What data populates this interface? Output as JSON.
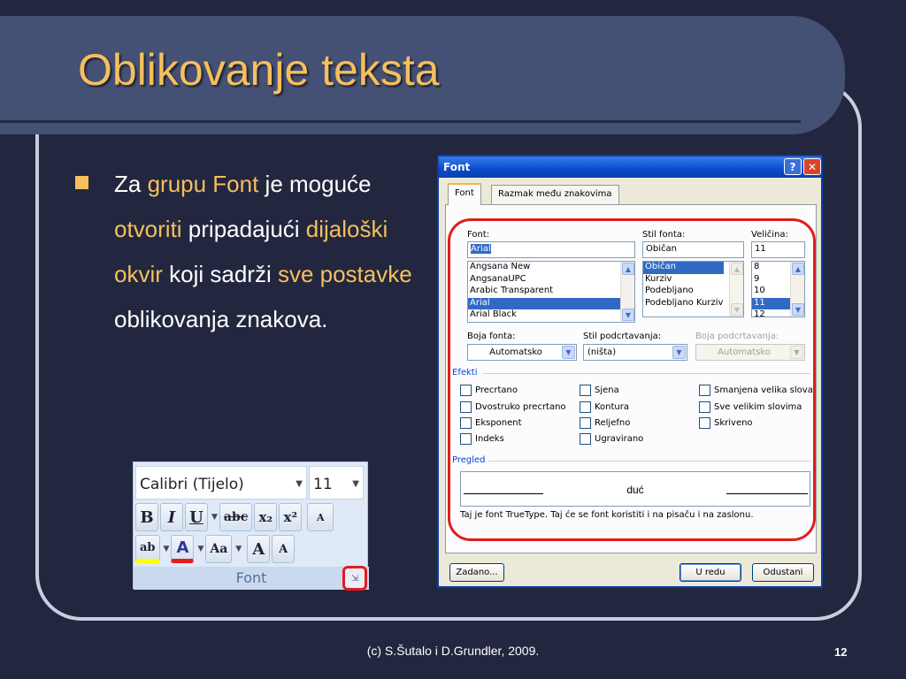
{
  "slide": {
    "title": "Oblikovanje teksta",
    "footer": "(c) S.Šutalo i D.Grundler, 2009.",
    "page_number": "12",
    "bullet": {
      "t1": "Za ",
      "t2": "grupu Font",
      "t3": " je moguće ",
      "t4": "otvoriti",
      "t5": " pripadajući ",
      "t6": "dijaloški okvir",
      "t7": " koji sadrži ",
      "t8": "sve postavke",
      "t9": " oblikovanja znakova."
    }
  },
  "ribbon": {
    "font_name": "Calibri (Tijelo)",
    "font_size": "11",
    "group_label": "Font",
    "buttons": {
      "bold": "B",
      "italic": "I",
      "underline": "U",
      "strikethrough": "abc",
      "subscript": "x₂",
      "superscript": "x²",
      "clear": "A",
      "highlight": "ab",
      "font_color": "A",
      "change_case": "Aa",
      "grow": "A",
      "shrink": "A"
    }
  },
  "dialog": {
    "title": "Font",
    "help": "?",
    "close": "✕",
    "tabs": [
      "Font",
      "Razmak među znakovima"
    ],
    "font_label": "Font:",
    "font_value": "Arial",
    "font_list": [
      "Angsana New",
      "AngsanaUPC",
      "Arabic Transparent",
      "Arial",
      "Arial Black"
    ],
    "font_selected": "Arial",
    "style_label": "Stil fonta:",
    "style_value": "Običan",
    "style_list": [
      "Običan",
      "Kurziv",
      "Podebljano",
      "Podebljano Kurziv"
    ],
    "size_label": "Veličina:",
    "size_value": "11",
    "size_list": [
      "8",
      "9",
      "10",
      "11",
      "12"
    ],
    "color_label": "Boja fonta:",
    "color_value": "Automatsko",
    "underline_label": "Stil podcrtavanja:",
    "underline_value": "(ništa)",
    "underline_color_label": "Boja podcrtavanja:",
    "underline_color_value": "Automatsko",
    "effects_label": "Efekti",
    "effects": {
      "col1": [
        "Precrtano",
        "Dvostruko precrtano",
        "Eksponent",
        "Indeks"
      ],
      "col2": [
        "Sjena",
        "Kontura",
        "Reljefno",
        "Ugravirano"
      ],
      "col3": [
        "Smanjena velika slova",
        "Sve velikim slovima",
        "Skriveno"
      ]
    },
    "preview_label": "Pregled",
    "preview_text": "duć",
    "preview_note": "Taj je font TrueType. Taj će se font koristiti i na pisaču i na zaslonu.",
    "btn_default": "Zadano...",
    "btn_ok": "U redu",
    "btn_cancel": "Odustani"
  },
  "colors": {
    "background": "#22273f",
    "title_band": "#455174",
    "accent": "#f6bf5d",
    "highlight_red": "#e31c1c"
  }
}
